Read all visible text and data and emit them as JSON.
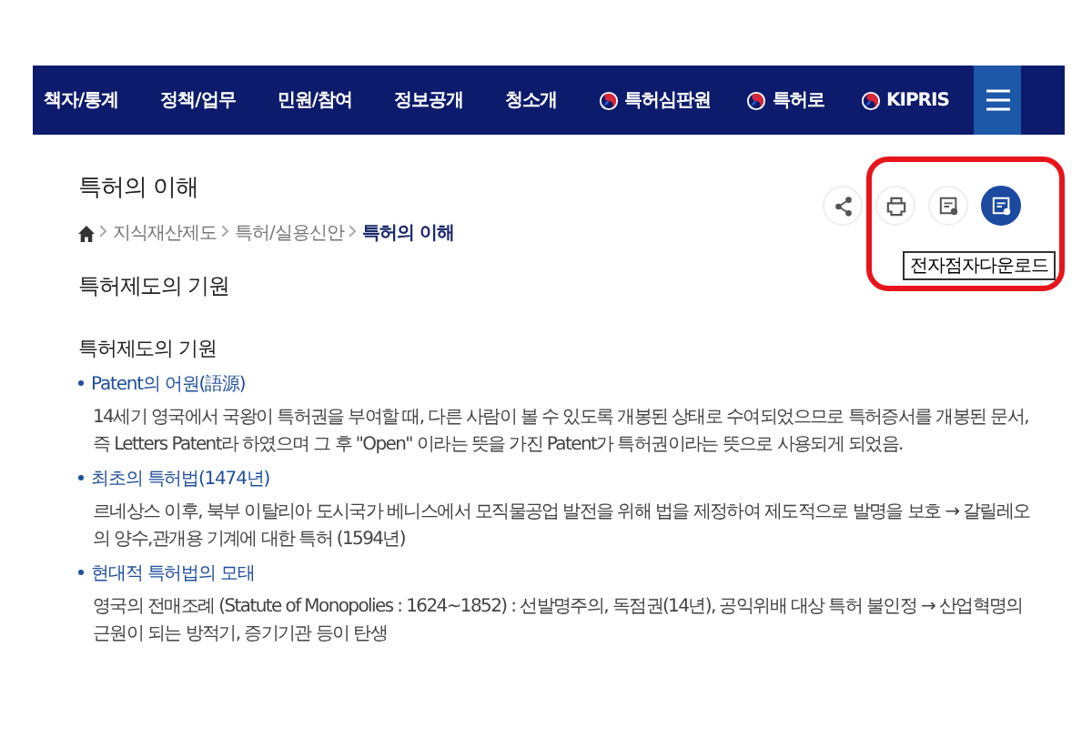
{
  "nav": {
    "items": [
      {
        "label": "책자/통계",
        "kind": "text"
      },
      {
        "label": "정책/업무",
        "kind": "text"
      },
      {
        "label": "민원/참여",
        "kind": "text"
      },
      {
        "label": "정보공개",
        "kind": "text"
      },
      {
        "label": "청소개",
        "kind": "text"
      },
      {
        "label": "특허심판원",
        "kind": "emblem"
      },
      {
        "label": "특허로",
        "kind": "emblem"
      },
      {
        "label": "KIPRIS",
        "kind": "emblem"
      }
    ]
  },
  "page_title": "특허의 이해",
  "breadcrumb": [
    {
      "label": "지식재산제도",
      "current": false
    },
    {
      "label": "특허/실용신안",
      "current": false
    },
    {
      "label": "특허의 이해",
      "current": true
    }
  ],
  "tools": [
    {
      "kind": "share",
      "active": false
    },
    {
      "kind": "print",
      "active": false
    },
    {
      "kind": "document",
      "active": false
    },
    {
      "kind": "document",
      "active": true
    }
  ],
  "tooltip": "전자점자다운로드",
  "highlight_frame": true,
  "section_heading": "특허제도의 기원",
  "subheading": "특허제도의 기원",
  "items": [
    {
      "title": "Patent의 어원(語源)",
      "body": "14세기 영국에서 국왕이 특허권을 부여할 때, 다른 사람이 볼 수 있도록 개봉된 상태로 수여되었으므로 특허증서를 개봉된 문서, 즉 Letters Patent라 하였으며 그 후 \"Open\" 이라는 뜻을 가진 Patent가 특허권이라는 뜻으로 사용되게 되었음."
    },
    {
      "title": "최초의 특허법(1474년)",
      "body": "르네상스 이후, 북부 이탈리아 도시국가 베니스에서 모직물공업 발전을 위해 법을 제정하여 제도적으로 발명을 보호 → 갈릴레오의 양수,관개용 기계에 대한 특허 (1594년)"
    },
    {
      "title": "현대적 특허법의 모태",
      "body": "영국의 전매조례 (Statute of Monopolies : 1624~1852) : 선발명주의, 독점권(14년), 공익위배 대상 특허 불인정 → 산업혁명의 근원이 되는 방적기, 증기기관 등이 탄생"
    }
  ]
}
